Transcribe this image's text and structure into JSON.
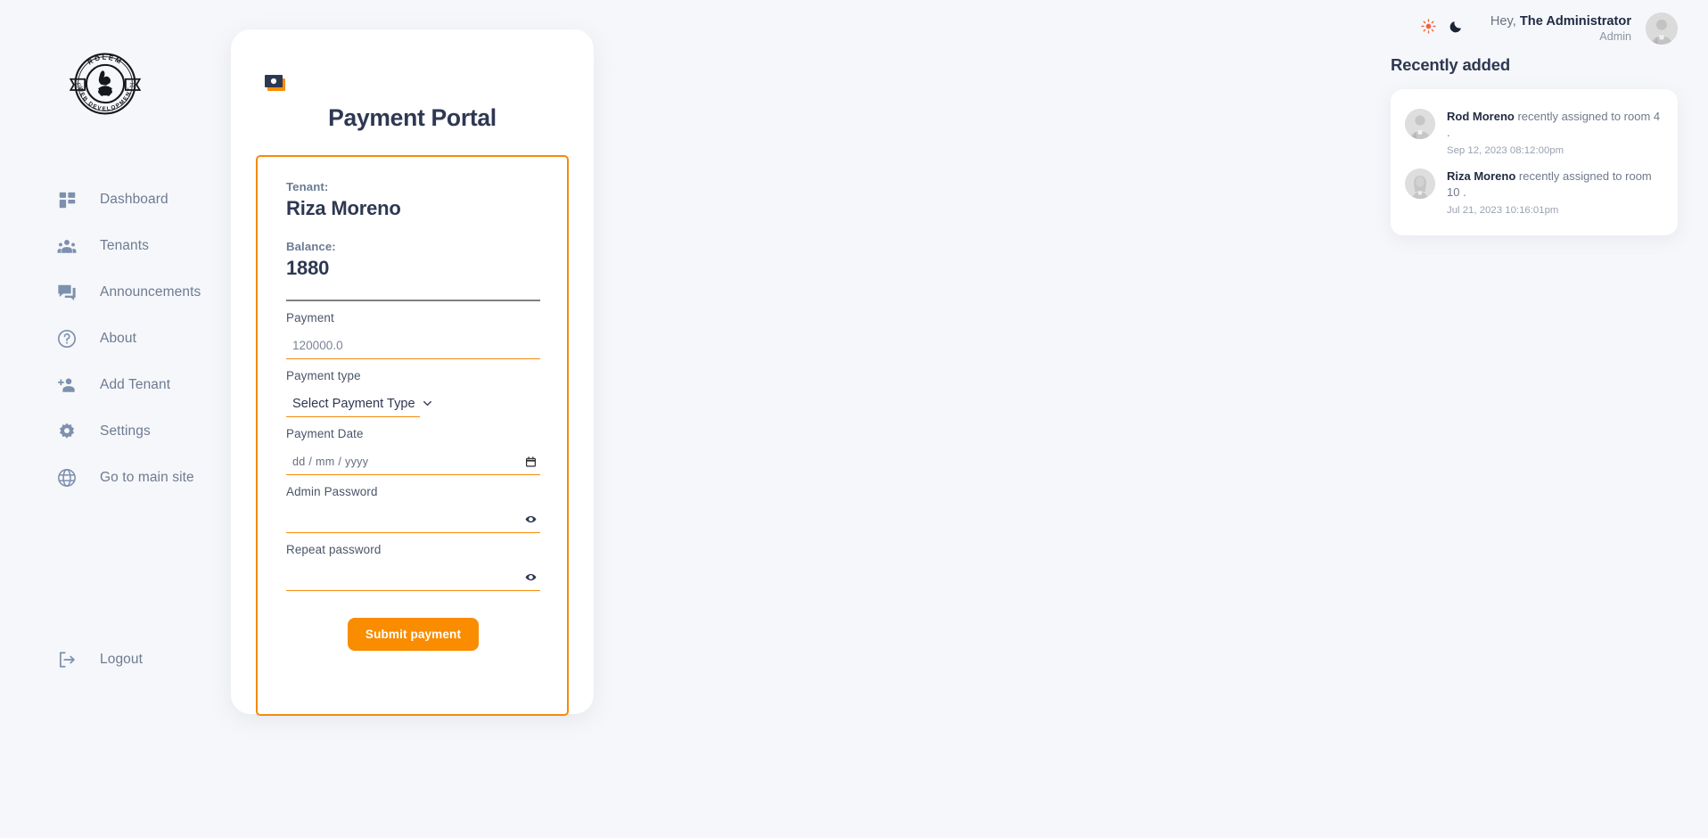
{
  "brand": {
    "logo_top_text": "ROLEM",
    "logo_bottom_text": "WEB DEVELOPMENT",
    "logo_year_left": "20",
    "logo_year_right": "23"
  },
  "colors": {
    "accent_orange": "#fa8c00",
    "dark_navy": "#2f3852",
    "muted_blue": "#6b7b95",
    "page_bg": "#f6f7fa",
    "sun_icon": "#f4623a"
  },
  "sidebar": {
    "items": [
      {
        "label": "Dashboard",
        "icon": "dashboard-icon"
      },
      {
        "label": "Tenants",
        "icon": "people-group-icon"
      },
      {
        "label": "Announcements",
        "icon": "chat-bubbles-icon"
      },
      {
        "label": "About",
        "icon": "question-circle-icon"
      },
      {
        "label": "Add Tenant",
        "icon": "person-add-icon"
      },
      {
        "label": "Settings",
        "icon": "gear-icon"
      },
      {
        "label": "Go to main site",
        "icon": "globe-icon"
      }
    ],
    "logout": {
      "label": "Logout",
      "icon": "logout-arrow-icon"
    }
  },
  "topbar": {
    "light_mode_icon": "sun-icon",
    "dark_mode_icon": "moon-icon",
    "greeting_prefix": "Hey, ",
    "user_name": "The Administrator",
    "user_role": "Admin",
    "avatar": "user-avatar"
  },
  "card": {
    "icon": "money-bills-icon",
    "title": "Payment Portal",
    "tenant_label": "Tenant:",
    "tenant_name": "Riza Moreno",
    "balance_label": "Balance:",
    "balance_value": "1880",
    "fields": {
      "payment_label": "Payment",
      "payment_placeholder": "120000.0",
      "payment_value": "",
      "payment_type_label": "Payment type",
      "payment_type_selected": "Select Payment Type",
      "payment_type_options": [
        "Select Payment Type"
      ],
      "payment_date_label": "Payment Date",
      "payment_date_placeholder": "dd / mm / yyyy",
      "payment_date_value": "",
      "admin_password_label": "Admin Password",
      "admin_password_value": "",
      "repeat_password_label": "Repeat password",
      "repeat_password_value": ""
    },
    "submit_label": "Submit payment"
  },
  "recently_added": {
    "title": "Recently added",
    "items": [
      {
        "name": "Rod Moreno",
        "text": " recently assigned to room 4 .",
        "time": "Sep 12, 2023 08:12:00pm",
        "avatar": "male-avatar"
      },
      {
        "name": "Riza Moreno",
        "text": " recently assigned to room 10 .",
        "time": "Jul 21, 2023 10:16:01pm",
        "avatar": "female-avatar"
      }
    ]
  }
}
